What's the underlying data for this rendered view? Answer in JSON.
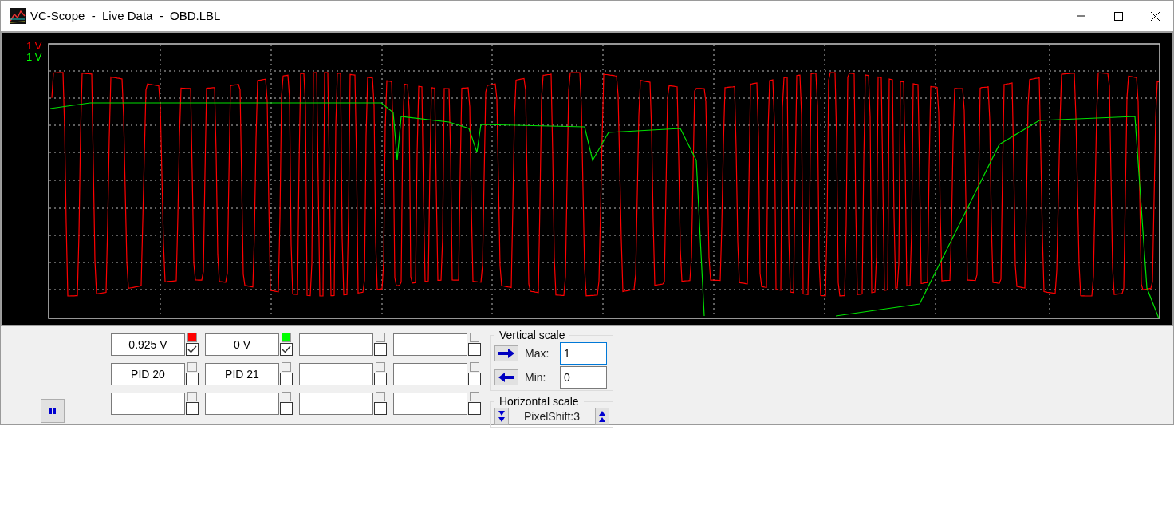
{
  "window": {
    "title": "VC-Scope  -  Live Data  -  OBD.LBL"
  },
  "scope": {
    "scale_labels": [
      {
        "text": "1 V",
        "color": "#ff0000"
      },
      {
        "text": "1 V",
        "color": "#00ff00"
      }
    ]
  },
  "channels": {
    "rows": [
      [
        {
          "value": "0.925 V",
          "color": "#ff0000",
          "checked": true
        },
        {
          "value": "0 V",
          "color": "#00ff00",
          "checked": true
        },
        {
          "checked": false
        },
        {
          "checked": false
        }
      ],
      [
        {
          "value": "PID 20",
          "checked": false
        },
        {
          "value": "PID 21",
          "checked": false
        },
        {
          "checked": false
        },
        {
          "checked": false
        }
      ],
      [
        {
          "checked": false
        },
        {
          "checked": false
        },
        {
          "checked": false
        },
        {
          "checked": false
        }
      ]
    ]
  },
  "vertical_scale": {
    "title": "Vertical scale",
    "max_label": "Max:",
    "max_value": "1",
    "max_focused": true,
    "min_label": "Min:",
    "min_value": "0"
  },
  "horizontal_scale": {
    "title": "Horizontal scale",
    "reading": "PixelShift:3"
  }
}
